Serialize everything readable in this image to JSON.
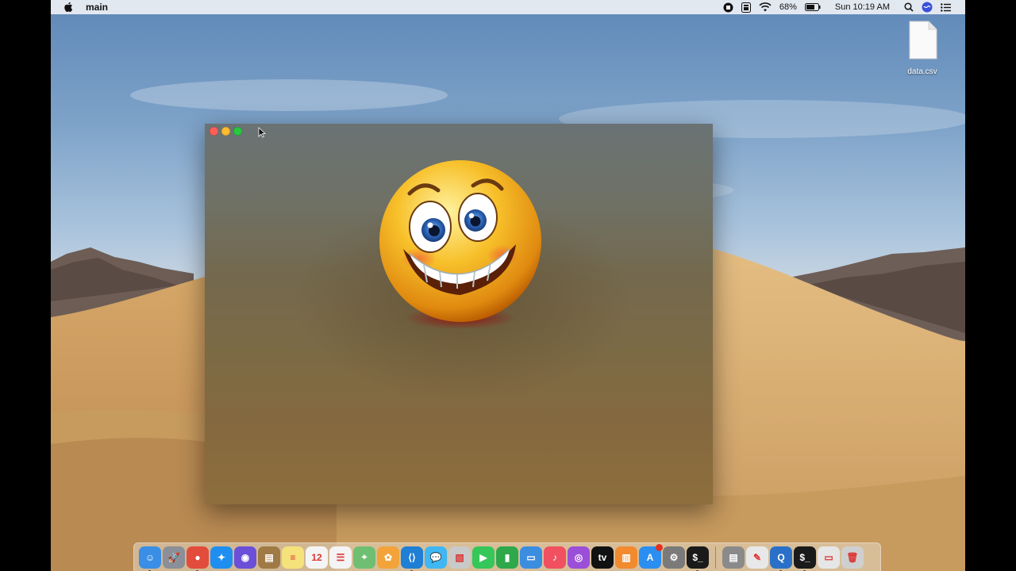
{
  "menubar": {
    "app_name": "main",
    "battery_percent": "68%",
    "clock": "Sun 10:19 AM",
    "icons": [
      "apple-icon",
      "screen-record-icon",
      "accessibility-icon",
      "wifi-icon",
      "battery-icon",
      "spotlight-icon",
      "siri-icon",
      "notification-center-icon"
    ]
  },
  "desktop": {
    "file_label": "data.csv"
  },
  "window": {
    "content": "grinning-emoji-image",
    "controls": [
      "close",
      "minimize",
      "zoom"
    ],
    "colors": {
      "close": "#ff5f57",
      "minimize": "#febc2e",
      "zoom": "#28c840"
    }
  },
  "dock": {
    "apps": [
      {
        "name": "finder",
        "glyph": "☺",
        "color": "#3a8ee6"
      },
      {
        "name": "launchpad",
        "glyph": "🚀",
        "color": "#8a8f98"
      },
      {
        "name": "chrome",
        "glyph": "●",
        "color": "#e24c3c"
      },
      {
        "name": "safari",
        "glyph": "✦",
        "color": "#1e8ff0"
      },
      {
        "name": "siri",
        "glyph": "◉",
        "color": "#6b4fd8"
      },
      {
        "name": "contacts",
        "glyph": "▤",
        "color": "#a07a45"
      },
      {
        "name": "notes",
        "glyph": "≡",
        "color": "#f5e27a"
      },
      {
        "name": "calendar",
        "glyph": "12",
        "color": "#f4f4f4"
      },
      {
        "name": "reminders",
        "glyph": "☰",
        "color": "#f4f4f4"
      },
      {
        "name": "maps",
        "glyph": "⌖",
        "color": "#6fbf73"
      },
      {
        "name": "photos",
        "glyph": "✿",
        "color": "#f2a33a"
      },
      {
        "name": "vscode",
        "glyph": "⟨⟩",
        "color": "#1f7fd4"
      },
      {
        "name": "messages",
        "glyph": "💬",
        "color": "#3fb7f2"
      },
      {
        "name": "preview",
        "glyph": "▧",
        "color": "#c9c9c9"
      },
      {
        "name": "facetime",
        "glyph": "▶",
        "color": "#35c759"
      },
      {
        "name": "numbers",
        "glyph": "▮",
        "color": "#2ea84a"
      },
      {
        "name": "keynote",
        "glyph": "▭",
        "color": "#3b8de0"
      },
      {
        "name": "music",
        "glyph": "♪",
        "color": "#f05060"
      },
      {
        "name": "podcasts",
        "glyph": "◎",
        "color": "#9b4fd8"
      },
      {
        "name": "tv",
        "glyph": "tv",
        "color": "#111111"
      },
      {
        "name": "books",
        "glyph": "▥",
        "color": "#f28a2e"
      },
      {
        "name": "app-store",
        "glyph": "A",
        "color": "#2a8ff0",
        "badge": true
      },
      {
        "name": "system-preferences",
        "glyph": "⚙",
        "color": "#7a7a7a"
      },
      {
        "name": "terminal",
        "glyph": "$_",
        "color": "#1a1a1a"
      }
    ],
    "others": [
      {
        "name": "disk-utility",
        "glyph": "▤",
        "color": "#8a8a8a"
      },
      {
        "name": "textedit",
        "glyph": "✎",
        "color": "#e8e8e8"
      },
      {
        "name": "quicktime",
        "glyph": "Q",
        "color": "#2a70c8"
      },
      {
        "name": "terminal-window",
        "glyph": "$_",
        "color": "#1a1a1a"
      },
      {
        "name": "downloads-stack",
        "glyph": "▭",
        "color": "#e6e6e6"
      },
      {
        "name": "trash",
        "glyph": "🗑",
        "color": "#cfcfcf"
      }
    ]
  }
}
